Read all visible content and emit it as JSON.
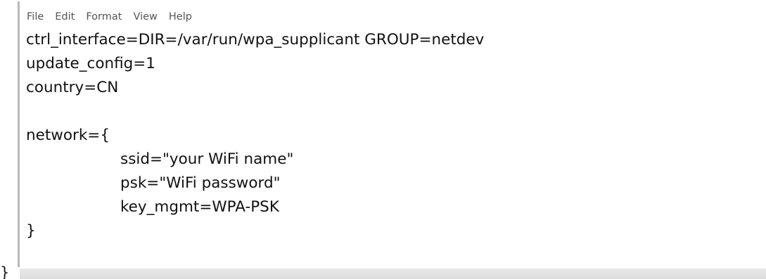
{
  "menu": {
    "items": [
      "File",
      "Edit",
      "Format",
      "View",
      "Help"
    ]
  },
  "editor": {
    "lines": [
      "ctrl_interface=DIR=/var/run/wpa_supplicant GROUP=netdev",
      "update_config=1",
      "country=CN",
      "",
      "network={",
      "ssid=\"your WiFi name\"",
      "psk=\"WiFi password\"",
      "key_mgmt=WPA-PSK",
      "}"
    ]
  },
  "stray_brace": "}"
}
